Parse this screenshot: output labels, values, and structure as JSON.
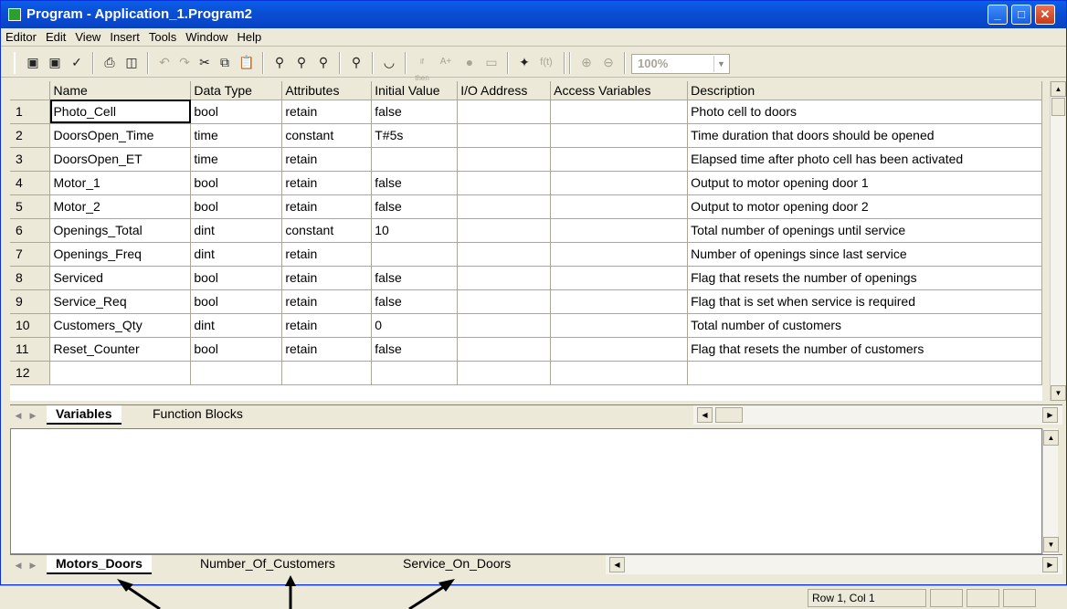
{
  "window": {
    "title": "Program - Application_1.Program2"
  },
  "menu": [
    "Editor",
    "Edit",
    "View",
    "Insert",
    "Tools",
    "Window",
    "Help"
  ],
  "toolbar": {
    "zoom": "100%"
  },
  "columns": [
    "Name",
    "Data Type",
    "Attributes",
    "Initial Value",
    "I/O Address",
    "Access Variables",
    "Description"
  ],
  "rows": [
    {
      "n": "1",
      "name": "Photo_Cell",
      "type": "bool",
      "attr": "retain",
      "init": "false",
      "io": "",
      "access": "",
      "desc": "Photo cell to doors"
    },
    {
      "n": "2",
      "name": "DoorsOpen_Time",
      "type": "time",
      "attr": "constant",
      "init": "T#5s",
      "io": "",
      "access": "",
      "desc": "Time duration that doors should be opened"
    },
    {
      "n": "3",
      "name": "DoorsOpen_ET",
      "type": "time",
      "attr": "retain",
      "init": "",
      "io": "",
      "access": "",
      "desc": "Elapsed time after photo cell has been activated"
    },
    {
      "n": "4",
      "name": "Motor_1",
      "type": "bool",
      "attr": "retain",
      "init": "false",
      "io": "",
      "access": "",
      "desc": "Output to motor opening door 1"
    },
    {
      "n": "5",
      "name": "Motor_2",
      "type": "bool",
      "attr": "retain",
      "init": "false",
      "io": "",
      "access": "",
      "desc": "Output to motor opening door 2"
    },
    {
      "n": "6",
      "name": "Openings_Total",
      "type": "dint",
      "attr": "constant",
      "init": "10",
      "io": "",
      "access": "",
      "desc": "Total number of openings until service"
    },
    {
      "n": "7",
      "name": "Openings_Freq",
      "type": "dint",
      "attr": "retain",
      "init": "",
      "io": "",
      "access": "",
      "desc": "Number of openings since last service"
    },
    {
      "n": "8",
      "name": "Serviced",
      "type": "bool",
      "attr": "retain",
      "init": "false",
      "io": "",
      "access": "",
      "desc": "Flag that resets the number of openings"
    },
    {
      "n": "9",
      "name": "Service_Req",
      "type": "bool",
      "attr": "retain",
      "init": "false",
      "io": "",
      "access": "",
      "desc": "Flag that is set when service is required"
    },
    {
      "n": "10",
      "name": "Customers_Qty",
      "type": "dint",
      "attr": "retain",
      "init": "0",
      "io": "",
      "access": "",
      "desc": "Total number of customers"
    },
    {
      "n": "11",
      "name": "Reset_Counter",
      "type": "bool",
      "attr": "retain",
      "init": "false",
      "io": "",
      "access": "",
      "desc": "Flag that resets the number of customers"
    },
    {
      "n": "12",
      "name": "",
      "type": "",
      "attr": "",
      "init": "",
      "io": "",
      "access": "",
      "desc": ""
    }
  ],
  "tabs_top": [
    "Variables",
    "Function Blocks"
  ],
  "tabs_bottom": [
    "Motors_Doors",
    "Number_Of_Customers",
    "Service_On_Doors"
  ],
  "status": {
    "position": "Row 1, Col 1"
  }
}
